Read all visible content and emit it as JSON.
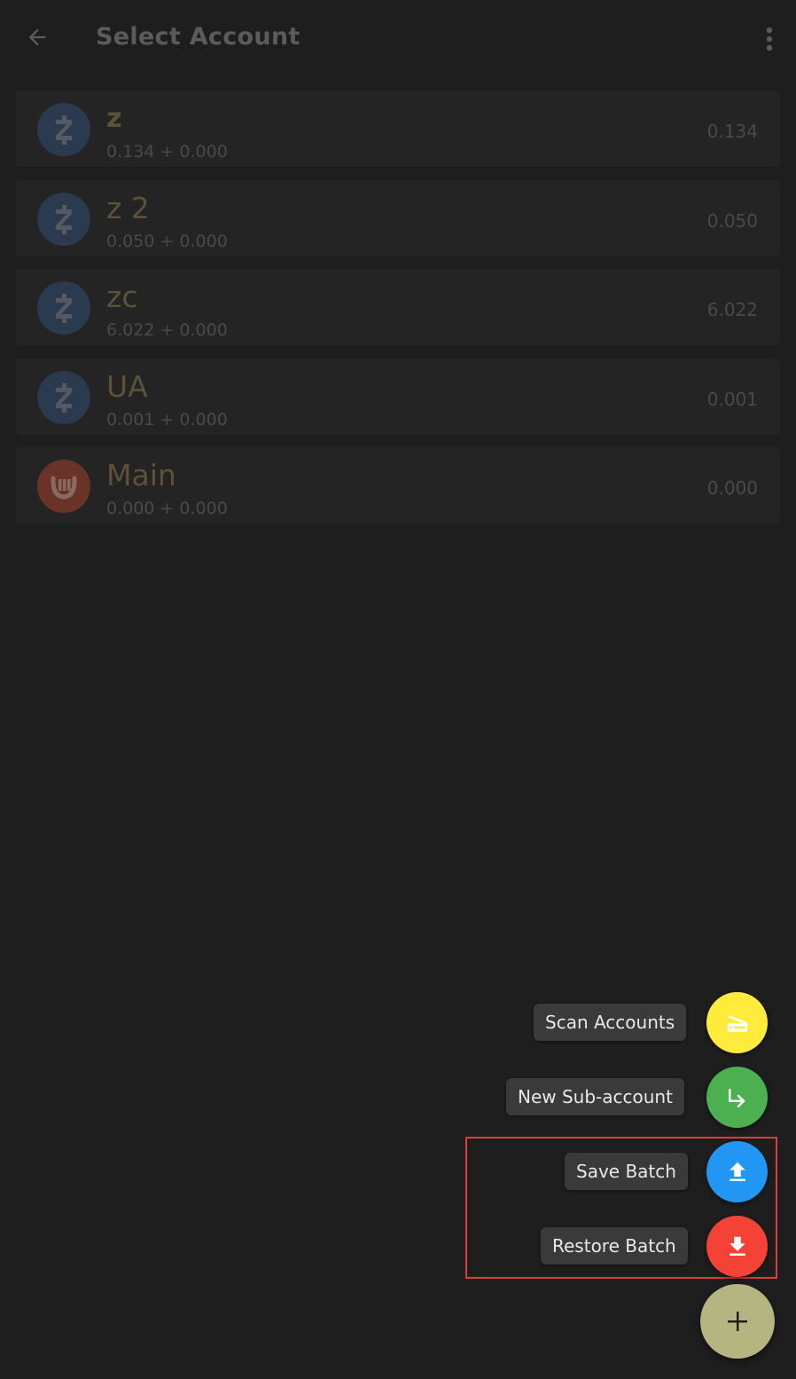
{
  "appbar": {
    "title": "Select Account",
    "back_icon": "arrow-back-icon",
    "more_icon": "more-vert-icon"
  },
  "accounts": [
    {
      "name": "z",
      "sub": "0.134 + 0.000",
      "balance": "0.134",
      "coin": "zcash"
    },
    {
      "name": "z 2",
      "sub": "0.050 + 0.000",
      "balance": "0.050",
      "coin": "zcash"
    },
    {
      "name": "zc",
      "sub": "6.022 + 0.000",
      "balance": "6.022",
      "coin": "zcash"
    },
    {
      "name": "UA",
      "sub": "0.001 + 0.000",
      "balance": "0.001",
      "coin": "zcash"
    },
    {
      "name": "Main",
      "sub": "0.000 + 0.000",
      "balance": "0.000",
      "coin": "ycash"
    }
  ],
  "speed_dial": {
    "scan": {
      "label": "Scan Accounts",
      "color": "#ffeb3b",
      "icon": "scanner-icon"
    },
    "sub_account": {
      "label": "New Sub-account",
      "color": "#4caf50",
      "icon": "subdirectory-arrow-icon"
    },
    "save_batch": {
      "label": "Save Batch",
      "color": "#2196f3",
      "icon": "upload-icon"
    },
    "restore_batch": {
      "label": "Restore Batch",
      "color": "#f44336",
      "icon": "download-icon"
    },
    "main_fab": {
      "color": "#b4b580",
      "icon": "plus-icon"
    }
  },
  "colors": {
    "background": "#1e1e1e",
    "highlight": "#e03c3c"
  }
}
